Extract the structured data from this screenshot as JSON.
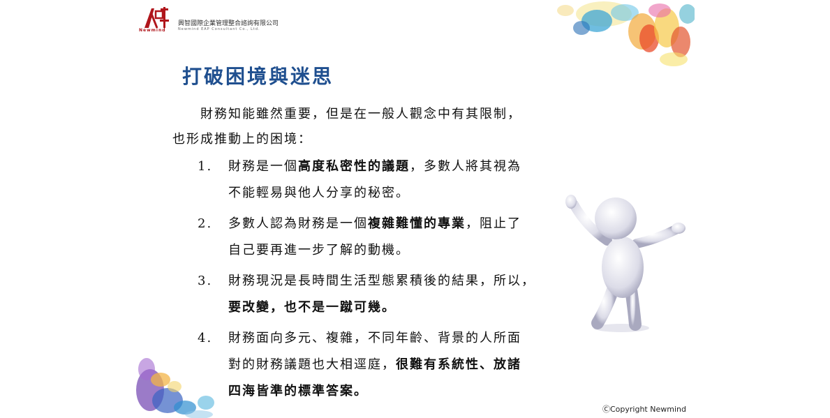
{
  "header": {
    "logo_text_en": "Newmind",
    "company_zh": "興智國際企業管理整合諮詢有限公司",
    "company_en": "Newmind EAP Consultant Co., Ltd."
  },
  "title": "打破困境與迷思",
  "intro": {
    "line1": "財務知能雖然重要，但是在一般人觀念中有其限制，",
    "line2": "也形成推動上的困境："
  },
  "items": [
    {
      "num": "1.",
      "l1a": "財務是一個",
      "l1b": "高度私密性的議題",
      "l1c": "，多數人將其視為",
      "l2": "不能輕易與他人分享的秘密。"
    },
    {
      "num": "2.",
      "l1a": "多數人認為財務是一個",
      "l1b": "複雜難懂的專業",
      "l1c": "，阻止了",
      "l2": "自己要再進一步了解的動機。"
    },
    {
      "num": "3.",
      "l1": "財務現況是長時間生活型態累積後的結果，所以，",
      "l2": "要改變，也不是一蹴可幾。"
    },
    {
      "num": "4.",
      "l1": "財務面向多元、複雜，不同年齡、背景的人所面",
      "l2a": "對的財務議題也大相逕庭，",
      "l2b": "很難有系統性、放諸",
      "l3": "四海皆準的標準答案。"
    }
  ],
  "copyright": "ⒸCopyright Newmind",
  "colors": {
    "title": "#1f4f8f",
    "logo": "#b0151b"
  }
}
